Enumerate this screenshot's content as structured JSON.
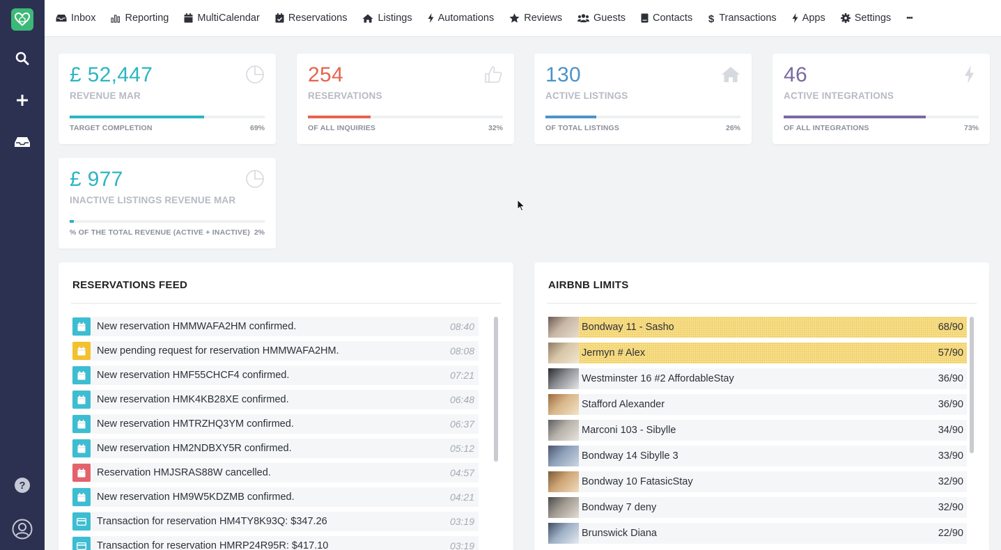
{
  "nav": {
    "items": [
      {
        "label": "Inbox",
        "icon": "inbox-icon"
      },
      {
        "label": "Reporting",
        "icon": "bar-chart-icon"
      },
      {
        "label": "MultiCalendar",
        "icon": "calendar-icon"
      },
      {
        "label": "Reservations",
        "icon": "calendar-check-icon"
      },
      {
        "label": "Listings",
        "icon": "home-icon"
      },
      {
        "label": "Automations",
        "icon": "bolt-icon"
      },
      {
        "label": "Reviews",
        "icon": "star-icon"
      },
      {
        "label": "Guests",
        "icon": "users-icon"
      },
      {
        "label": "Contacts",
        "icon": "address-book-icon"
      },
      {
        "label": "Transactions",
        "icon": "dollar-icon"
      },
      {
        "label": "Apps",
        "icon": "bolt-icon"
      },
      {
        "label": "Settings",
        "icon": "gear-icon"
      }
    ],
    "more_label": "•••"
  },
  "sidebar": {
    "icons": [
      "logo-icon",
      "search-icon",
      "plus-icon",
      "inbox-icon",
      "help-icon",
      "user-icon"
    ]
  },
  "stats": [
    {
      "value": "£ 52,447",
      "label": "REVENUE MAR",
      "footer": "TARGET COMPLETION",
      "percent": "69%",
      "fraction": 0.69,
      "color": "#2cb5c2",
      "icon": "pie-chart-icon"
    },
    {
      "value": "254",
      "label": "RESERVATIONS",
      "footer": "OF ALL INQUIRIES",
      "percent": "32%",
      "fraction": 0.32,
      "color": "#e5644e",
      "icon": "thumbs-up-icon"
    },
    {
      "value": "130",
      "label": "ACTIVE LISTINGS",
      "footer": "OF TOTAL LISTINGS",
      "percent": "26%",
      "fraction": 0.26,
      "color": "#4b93c9",
      "icon": "home-icon"
    },
    {
      "value": "46",
      "label": "ACTIVE INTEGRATIONS",
      "footer": "OF ALL INTEGRATIONS",
      "percent": "73%",
      "fraction": 0.73,
      "color": "#7a6aa0",
      "icon": "bolt-icon"
    },
    {
      "value": "£ 977",
      "label": "INACTIVE LISTINGS REVENUE MAR",
      "footer": "% OF THE TOTAL REVENUE (ACTIVE + INACTIVE)",
      "percent": "2%",
      "fraction": 0.02,
      "color": "#2cb5c2",
      "icon": "pie-chart-icon"
    }
  ],
  "feed": {
    "title": "RESERVATIONS FEED",
    "items": [
      {
        "text": "New reservation HMMWAFA2HM confirmed.",
        "time": "08:40",
        "kind": "confirmed"
      },
      {
        "text": "New pending request for reservation HMMWAFA2HM.",
        "time": "08:08",
        "kind": "pending"
      },
      {
        "text": "New reservation HMF55CHCF4 confirmed.",
        "time": "07:21",
        "kind": "confirmed"
      },
      {
        "text": "New reservation HMK4KB28XE confirmed.",
        "time": "06:48",
        "kind": "confirmed"
      },
      {
        "text": "New reservation HMTRZHQ3YM confirmed.",
        "time": "06:37",
        "kind": "confirmed"
      },
      {
        "text": "New reservation HM2NDBXY5R confirmed.",
        "time": "05:12",
        "kind": "confirmed"
      },
      {
        "text": "Reservation HMJSRAS88W cancelled.",
        "time": "04:57",
        "kind": "cancelled"
      },
      {
        "text": "New reservation HM9W5KDZMB confirmed.",
        "time": "04:21",
        "kind": "confirmed"
      },
      {
        "text": "Transaction for reservation HM4TY8K93Q: $347.26",
        "time": "03:19",
        "kind": "transaction"
      },
      {
        "text": "Transaction for reservation HMRP24R95R: $417.10",
        "time": "03:19",
        "kind": "transaction"
      }
    ],
    "colors": {
      "confirmed": "#3dbdd2",
      "pending": "#f2c12e",
      "cancelled": "#e4626c",
      "transaction": "#3dbdd2"
    }
  },
  "limits": {
    "title": "AIRBNB LIMITS",
    "items": [
      {
        "name": "Bondway 11 - Sasho",
        "value": "68/90",
        "used": 68,
        "max": 90,
        "highlight": true
      },
      {
        "name": "Jermyn # Alex",
        "value": "57/90",
        "used": 57,
        "max": 90,
        "highlight": true
      },
      {
        "name": "Westminster 16 #2 AffordableStay",
        "value": "36/90",
        "used": 36,
        "max": 90,
        "highlight": false
      },
      {
        "name": "Stafford Alexander",
        "value": "36/90",
        "used": 36,
        "max": 90,
        "highlight": false
      },
      {
        "name": "Marconi 103 - Sibylle",
        "value": "34/90",
        "used": 34,
        "max": 90,
        "highlight": false
      },
      {
        "name": "Bondway 14 Sibylle 3",
        "value": "33/90",
        "used": 33,
        "max": 90,
        "highlight": false
      },
      {
        "name": "Bondway 10 FatasicStay",
        "value": "32/90",
        "used": 32,
        "max": 90,
        "highlight": false
      },
      {
        "name": "Bondway 7 deny",
        "value": "32/90",
        "used": 32,
        "max": 90,
        "highlight": false
      },
      {
        "name": "Brunswick Diana",
        "value": "22/90",
        "used": 22,
        "max": 90,
        "highlight": false
      }
    ]
  }
}
